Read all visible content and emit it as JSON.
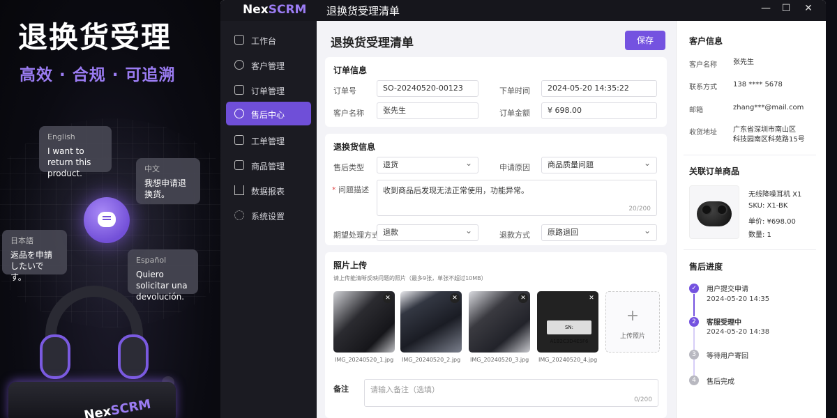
{
  "promo": {
    "title": "退换货受理",
    "subtitle": "高效 · 合规 · 可追溯",
    "bubbles": [
      {
        "lang": "English",
        "text": "I want to return this product."
      },
      {
        "lang": "中文",
        "text": "我想申请退换货。"
      },
      {
        "lang": "日本語",
        "text": "返品を申請したいです。"
      },
      {
        "lang": "Español",
        "text": "Quiero solicitar una devolución."
      }
    ],
    "brand_a": "Nex",
    "brand_b": "SCRM"
  },
  "app": {
    "logo_a": "Nex",
    "logo_b": "SCRM",
    "window_title": "退换货受理清单",
    "controls": {
      "min": "—",
      "max": "☐",
      "close": "✕"
    }
  },
  "sidebar": {
    "items": [
      {
        "label": "工作台",
        "icon": "workbench-icon"
      },
      {
        "label": "客户管理",
        "icon": "user-icon"
      },
      {
        "label": "订单管理",
        "icon": "order-icon"
      },
      {
        "label": "售后中心",
        "icon": "shield-icon",
        "active": true
      },
      {
        "label": "工单管理",
        "icon": "ticket-icon"
      },
      {
        "label": "商品管理",
        "icon": "box-icon"
      },
      {
        "label": "数据报表",
        "icon": "chart-icon"
      },
      {
        "label": "系统设置",
        "icon": "gear-icon"
      }
    ]
  },
  "main": {
    "title": "退换货受理清单",
    "save_label": "保存",
    "order": {
      "title": "订单信息",
      "order_no_label": "订单号",
      "order_no": "SO-20240520-00123",
      "order_time_label": "下单时间",
      "order_time": "2024-05-20  14:35:22",
      "customer_label": "客户名称",
      "customer": "张先生",
      "amount_label": "订单金额",
      "amount": "¥ 698.00"
    },
    "return": {
      "title": "退换货信息",
      "type_label": "售后类型",
      "type": "退货",
      "reason_label": "申请原因",
      "reason": "商品质量问题",
      "desc_label": "问题描述",
      "desc": "收到商品后发现无法正常使用，功能异常。",
      "desc_count": "20/200",
      "expect_label": "期望处理方式",
      "expect": "退款",
      "refund_label": "退款方式",
      "refund": "原路退回"
    },
    "photos": {
      "title": "照片上传",
      "hint": "请上传能清晰反映问题的照片（最多9张，单张不超过10MB）",
      "files": [
        "IMG_20240520_1.jpg",
        "IMG_20240520_2.jpg",
        "IMG_20240520_3.jpg",
        "IMG_20240520_4.jpg"
      ],
      "sn_text": "SN: A1B2C3D4E5F6",
      "upload_label": "上传照片",
      "upload_plus": "+"
    },
    "remark": {
      "label": "备注",
      "placeholder": "请输入备注（选填）",
      "count": "0/200"
    }
  },
  "right": {
    "customer": {
      "title": "客户信息",
      "name_label": "客户名称",
      "name": "张先生",
      "phone_label": "联系方式",
      "phone": "138 **** 5678",
      "email_label": "邮箱",
      "email": "zhang***@mail.com",
      "address_label": "收货地址",
      "address1": "广东省深圳市南山区",
      "address2": "科技园南区科苑路15号"
    },
    "product": {
      "title": "关联订单商品",
      "name": "无线降噪耳机 X1",
      "sku": "SKU:  X1-BK",
      "price": "单价:  ¥698.00",
      "qty": "数量:  1"
    },
    "progress": {
      "title": "售后进度",
      "steps": [
        {
          "num": "✓",
          "title": "用户提交申请",
          "time": "2024-05-20 14:35"
        },
        {
          "num": "2",
          "title": "客服受理中",
          "time": "2024-05-20 14:38"
        },
        {
          "num": "3",
          "title": "等待用户寄回",
          "time": ""
        },
        {
          "num": "4",
          "title": "售后完成",
          "time": ""
        }
      ]
    }
  },
  "colors": {
    "accent": "#7452e0",
    "sidebar": "#1b1b22",
    "titlebar": "#16161c"
  }
}
